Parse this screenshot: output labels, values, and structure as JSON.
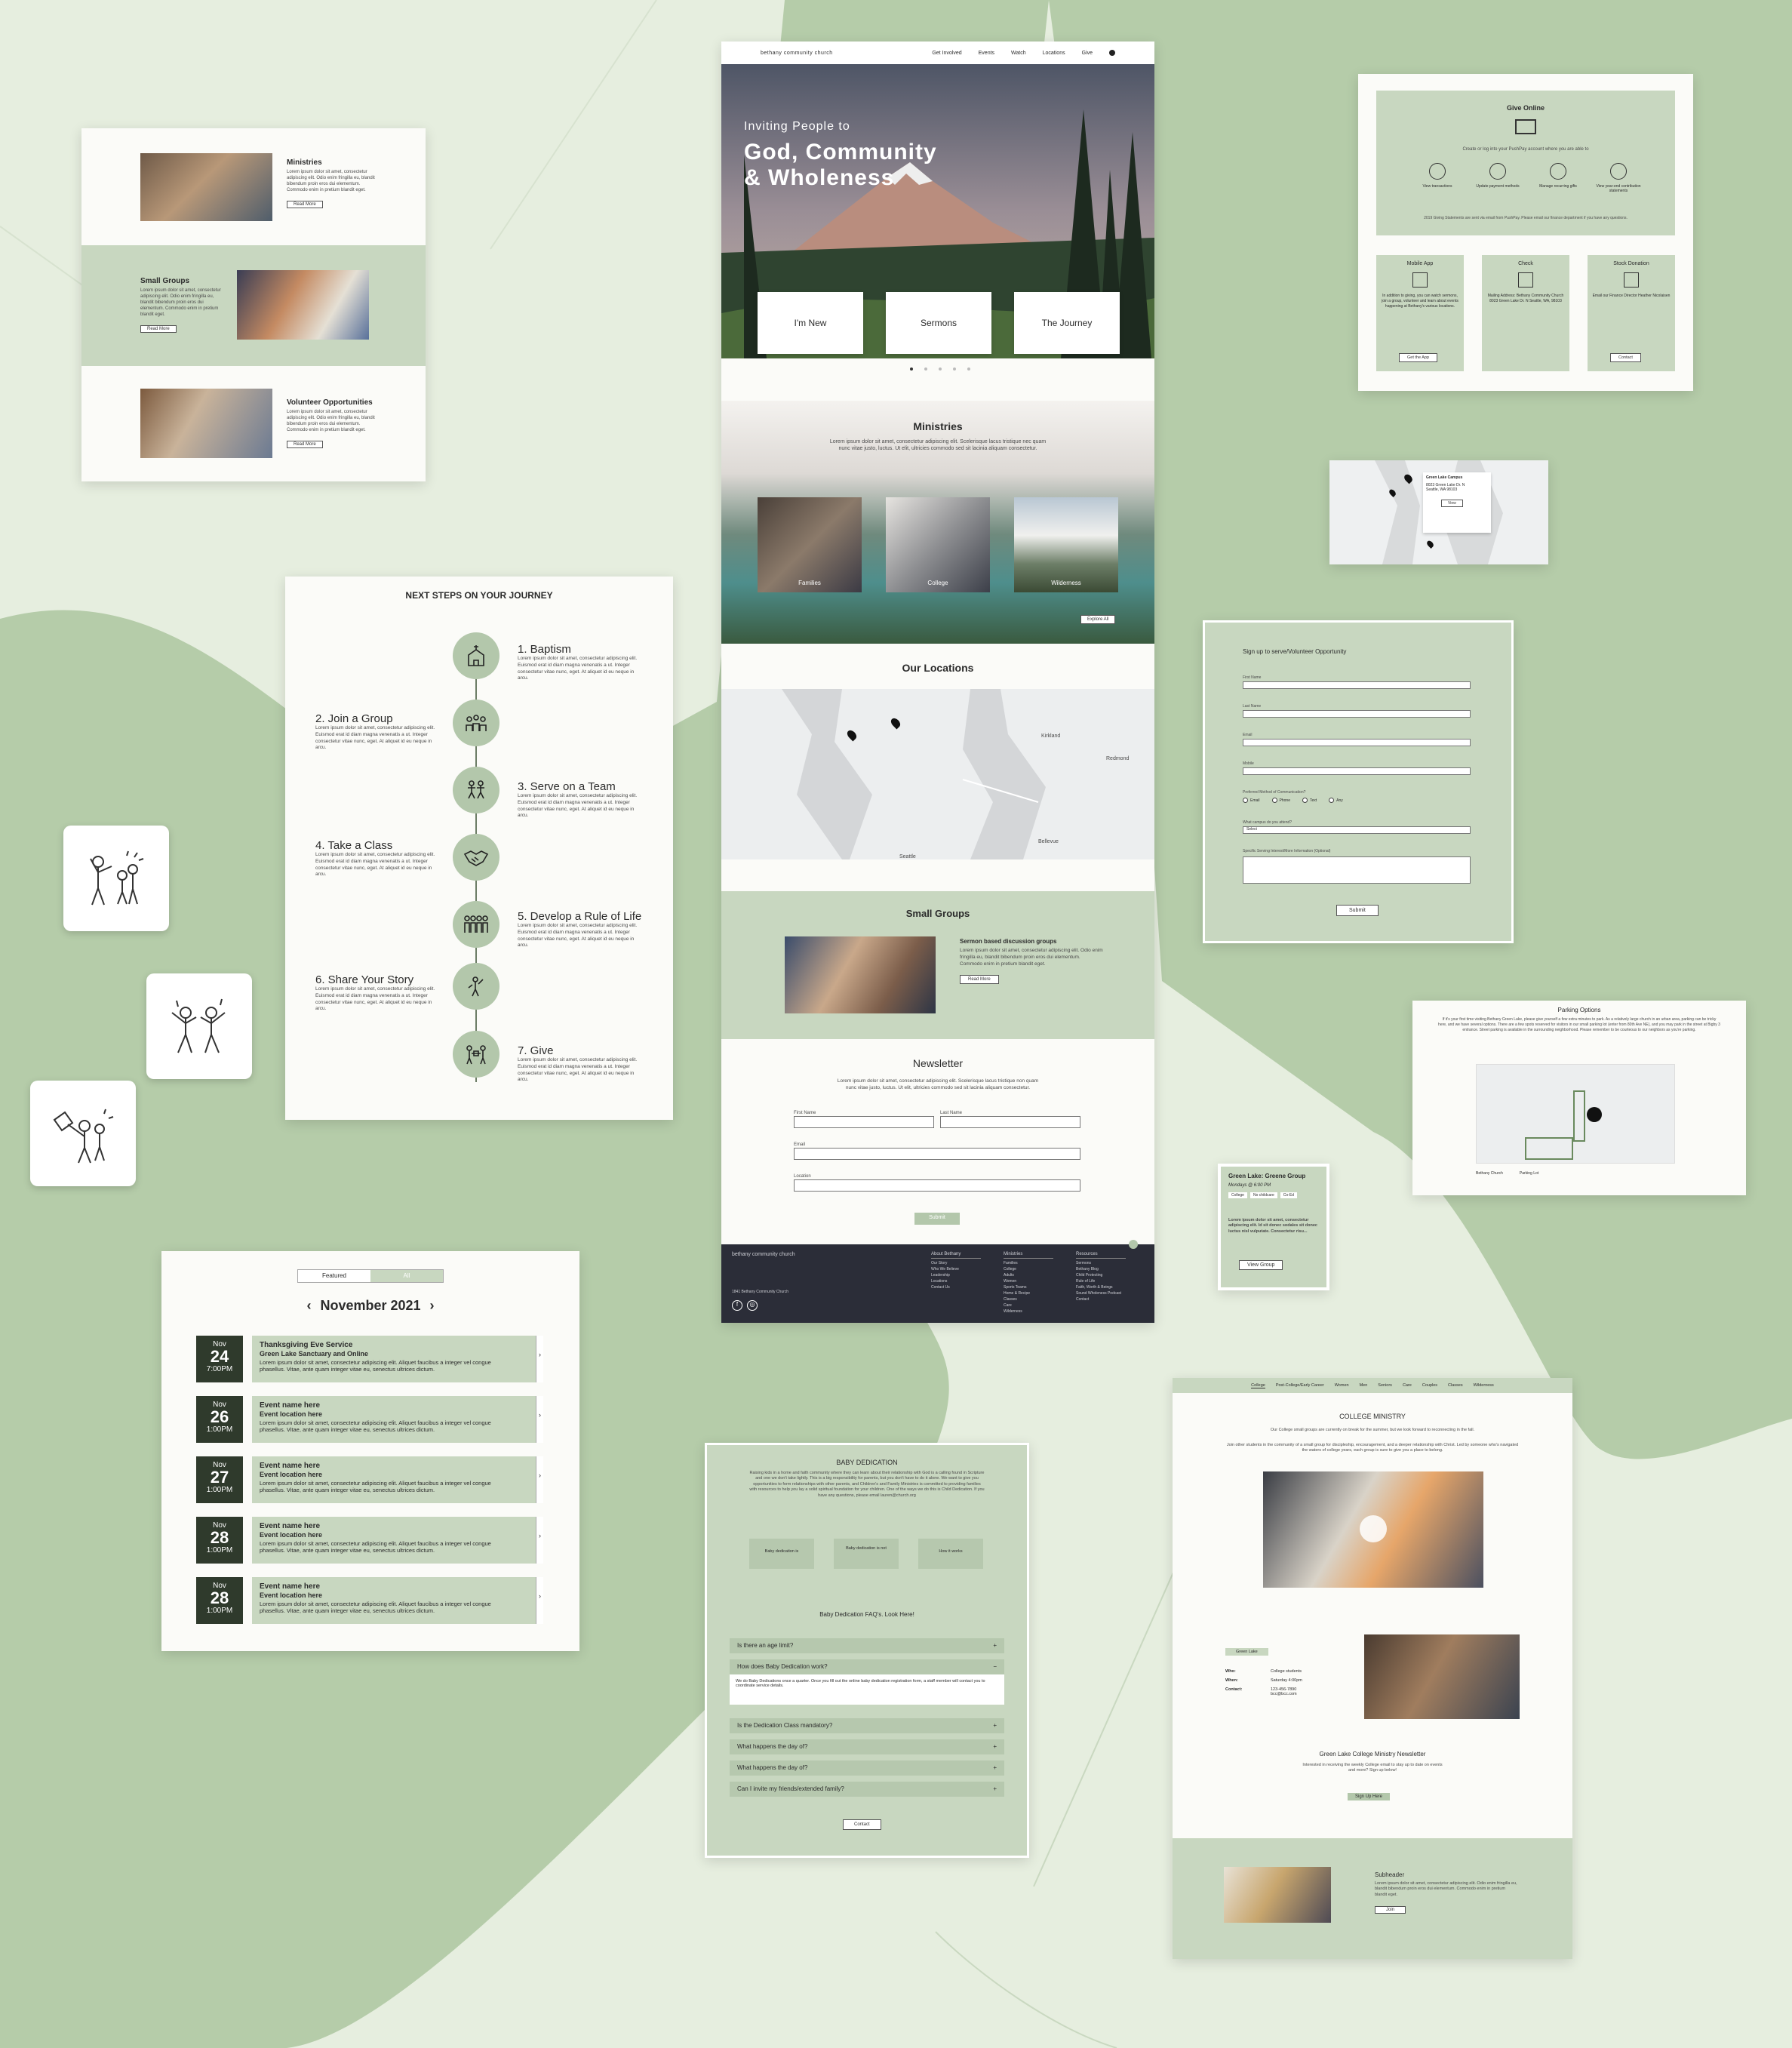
{
  "colors": {
    "sage": "#c8d7c0",
    "sage_dark": "#b3c7ab",
    "bg": "#e6eedf",
    "bg_shape": "#b5cca9",
    "footer": "#2b2d38"
  },
  "ministries_card": {
    "items": [
      {
        "title": "Ministries",
        "body": "Lorem ipsum dolor sit amet, consectetur adipiscing elit. Odio enim fringilla eu, blandit bibendum proin eros dui elementum. Commodo enim in pretium blandit eget.",
        "button": "Read More"
      },
      {
        "title": "Small Groups",
        "body": "Lorem ipsum dolor sit amet, consectetur adipiscing elit. Odio enim fringilla eu, blandit bibendum proin eros dui elementum. Commodo enim in pretium blandit eget.",
        "button": "Read More"
      },
      {
        "title": "Volunteer Opportunities",
        "body": "Lorem ipsum dolor sit amet, consectetur adipiscing elit. Odio enim fringilla eu, blandit bibendum proin eros dui elementum. Commodo enim in pretium blandit eget.",
        "button": "Read More"
      }
    ]
  },
  "journey": {
    "title": "NEXT STEPS ON YOUR JOURNEY",
    "body": "Lorem ipsum dolor sit amet, consectetur adipiscing elit. Euismod erat id diam magna venenatis a ut. Integer consectetur vitae nunc, eget. At aliquet id eu neque in arcu.",
    "steps": [
      "1. Baptism",
      "2. Join a Group",
      "3. Serve on a Team",
      "4. Take a Class",
      "5. Develop a Rule of Life",
      "6. Share Your Story",
      "7. Give"
    ]
  },
  "events": {
    "tabs": [
      "Featured",
      "All"
    ],
    "month": "November 2021",
    "items": [
      {
        "mon": "Nov",
        "day": "24",
        "time": "7:00PM",
        "name": "Thanksgiving Eve Service",
        "loc": "Green Lake Sanctuary and Online",
        "desc": "Lorem ipsum dolor sit amet, consectetur adipiscing elit. Aliquet faucibus a integer vel congue phasellus. Vitae, ante quam integer vitae eu, senectus ultrices dictum."
      },
      {
        "mon": "Nov",
        "day": "26",
        "time": "1:00PM",
        "name": "Event name here",
        "loc": "Event location here",
        "desc": "Lorem ipsum dolor sit amet, consectetur adipiscing elit. Aliquet faucibus a integer vel congue phasellus. Vitae, ante quam integer vitae eu, senectus ultrices dictum."
      },
      {
        "mon": "Nov",
        "day": "27",
        "time": "1:00PM",
        "name": "Event name here",
        "loc": "Event location here",
        "desc": "Lorem ipsum dolor sit amet, consectetur adipiscing elit. Aliquet faucibus a integer vel congue phasellus. Vitae, ante quam integer vitae eu, senectus ultrices dictum."
      },
      {
        "mon": "Nov",
        "day": "28",
        "time": "1:00PM",
        "name": "Event name here",
        "loc": "Event location here",
        "desc": "Lorem ipsum dolor sit amet, consectetur adipiscing elit. Aliquet faucibus a integer vel congue phasellus. Vitae, ante quam integer vitae eu, senectus ultrices dictum."
      },
      {
        "mon": "Nov",
        "day": "28",
        "time": "1:00PM",
        "name": "Event name here",
        "loc": "Event location here",
        "desc": "Lorem ipsum dolor sit amet, consectetur adipiscing elit. Aliquet faucibus a integer vel congue phasellus. Vitae, ante quam integer vitae eu, senectus ultrices dictum."
      }
    ]
  },
  "home": {
    "logo": "bethany community church",
    "nav": [
      "Get Involved",
      "Events",
      "Watch",
      "Locations",
      "Give"
    ],
    "hero_kicker": "Inviting People to",
    "hero_title1": "God, Community",
    "hero_title2": "& Wholeness",
    "cards": [
      "I'm New",
      "Sermons",
      "The Journey"
    ],
    "ministries_title": "Ministries",
    "ministries_body": "Lorem ipsum dolor sit amet, consectetur adipiscing elit. Scelerisque lacus tristique nec quam nunc vitae justo, luctus. Ut elit, ultricies commodo sed sit lacinia aliquam consectetur.",
    "ministry_photos": [
      "Families",
      "College",
      "Wilderness"
    ],
    "explore": "Explore All",
    "locations_title": "Our Locations",
    "map_labels": [
      "Seattle",
      "Bellevue",
      "Kirkland",
      "Redmond"
    ],
    "groups_title": "Small Groups",
    "groups_sub": "Sermon based discussion groups",
    "groups_body": "Lorem ipsum dolor sit amet, consectetur adipiscing elit. Odio enim fringilla eu, blandit bibendum proin eros dui elementum. Commodo enim in pretium blandit eget.",
    "groups_button": "Read More",
    "newsletter_title": "Newsletter",
    "newsletter_body": "Lorem ipsum dolor sit amet, consectetur adipiscing elit. Scelerisque lacus tristique non quam nunc vitae justo, luctus. Ut elit, ultricies commodo sed sit lacinia aliquam consectetur.",
    "fields": [
      "First Name",
      "Last Name",
      "Email",
      "Location"
    ],
    "submit": "Submit",
    "footer_cols": [
      {
        "title": "About Bethany",
        "items": [
          "Our Story",
          "Who We Believe",
          "Leadership",
          "Locations",
          "Contact Us"
        ]
      },
      {
        "title": "Ministries",
        "items": [
          "Families",
          "College",
          "Adults",
          "Women",
          "Sports Teams",
          "Home & Recipe",
          "Classes",
          "Care",
          "Wilderness"
        ]
      },
      {
        "title": "Resources",
        "items": [
          "Sermons",
          "Bethany Blog",
          "Child Protecting",
          "Rule of Life",
          "Faith, Worth & Beings",
          "Sound Wholeness Podcast",
          "Contact"
        ]
      }
    ],
    "footer_address": "1841 Bethany Community Church"
  },
  "give": {
    "title": "Give Online",
    "sub": "Create or log into your PushPay account where you are able to",
    "options": [
      "View transactions",
      "Update payment methods",
      "Manage recurring gifts",
      "View year-end contribution statements"
    ],
    "note": "2019 Giving Statements are sent via email from PushPay. Please email our finance department if you have any questions.",
    "cards": [
      {
        "title": "Mobile App",
        "body": "In addition to giving, you can watch sermons, join a group, volunteer and learn about events happening at Bethany's various locations.",
        "button": "Get the App"
      },
      {
        "title": "Check",
        "body": "Mailing Address: Bethany Community Church 8023 Green Lake Dr. N Seattle, WA, 98103",
        "button": ""
      },
      {
        "title": "Stock Donation",
        "body": "Email our Finance Director Heather Nicolaisen",
        "button": "Contact"
      }
    ]
  },
  "map_popup": {
    "title": "Green Lake Campus",
    "lines": [
      "8023 Green Lake Dr. N",
      "Seattle, WA 98103"
    ],
    "button": "View"
  },
  "volunteer": {
    "title": "Sign up to serve/Volunteer Opportunity",
    "fields": [
      "First Name",
      "Last Name",
      "Email",
      "Mobile"
    ],
    "method_label": "Preferred Method of Communication?",
    "methods": [
      "Email",
      "Phone",
      "Text",
      "Any"
    ],
    "campus_label": "What campus do you attend?",
    "campus_value": "Select",
    "interest_label": "Specific Serving Interest/More Information (Optional)",
    "submit": "Submit"
  },
  "parking": {
    "title": "Parking Options",
    "body": "If it's your first time visiting Bethany Green Lake, please give yourself a few extra minutes to park. As a relatively large church in an urban area, parking can be tricky here, and we have several options. There are a few spots reserved for visitors in our small parking lot (enter from 80th Ave NE), and you may park in the street at Bigby 3 entrance. Street parking is available in the surrounding neighborhood. Please remember to be courteous to our neighbors as you're parking.",
    "legend": [
      "Bethany Church",
      "Parking Lot"
    ]
  },
  "group_card": {
    "title": "Green Lake: Greene Group",
    "time": "Mondays @ 6:00 PM",
    "tags": [
      "College",
      "No childcare",
      "Co-Ed"
    ],
    "body": "Lorem ipsum dolor sit amet, consectetur adipiscing elit. Id sit donec sodales sit donec luctus nisl vulputate. Consectetur risu...",
    "button": "View Group"
  },
  "baby": {
    "title": "BABY DEDICATION",
    "body": "Raising kids in a home and faith community where they can learn about their relationship with God is a calling found in Scripture and one we don't take lightly. This is a big responsibility for parents, but you don't have to do it alone. We want to give you opportunities to form relationships with other parents, and Children's and Family Ministries is committed to providing families with resources to help you lay a solid spiritual foundation for your children. One of the ways we do this is Child Dedication. If you have any questions, please email lauren@church.org",
    "boxes": [
      "Baby dedication is",
      "Baby dedication is not",
      "How it works"
    ],
    "faq_title": "Baby Dedication FAQ's.  Look Here!",
    "faqs": [
      "Is there an age limit?",
      "How does Baby Dedication work?",
      "Is the Dedication Class mandatory?",
      "What happens the day of?",
      "What happens the day of?",
      "Can I invite my friends/extended family?"
    ],
    "answer": "We do Baby Dedications once a quarter. Once you fill out the online baby dedication registration form, a staff member will contact you to coordinate service details.",
    "button": "Contact"
  },
  "college": {
    "tabs": [
      "College",
      "Post-College/Early Career",
      "Women",
      "Men",
      "Seniors",
      "Care",
      "Couples",
      "Classes",
      "Wilderness"
    ],
    "title": "COLLEGE MINISTRY",
    "intro1": "Our College small groups are currently on break for the summer, but we look forward to reconnecting in the fall.",
    "intro2": "Join other students in the community of a small group for discipleship, encouragement, and a deeper relationship with Christ. Led by someone who's navigated the waters of college years, each group is sure to give you a place to belong.",
    "campus": "Green Lake",
    "info": [
      [
        "Who:",
        "College students"
      ],
      [
        "When:",
        "Saturday 4:00pm"
      ],
      [
        "Contact:",
        "123-456-7890 bcc@bcc.com"
      ]
    ],
    "nl_title": "Green Lake College Ministry Newsletter",
    "nl_body": "Interested in receiving the weekly College email to stay up to date on events and more? Sign up below!",
    "nl_button": "Sign Up Here",
    "sub_title": "Subheader",
    "sub_body": "Lorem ipsum dolor sit amet, consectetur adipiscing elit. Odio enim fringilla eu, blandit bibendum proin eros dui elementum. Commodo enim in pretium blandit eget.",
    "sub_button": "Join"
  }
}
